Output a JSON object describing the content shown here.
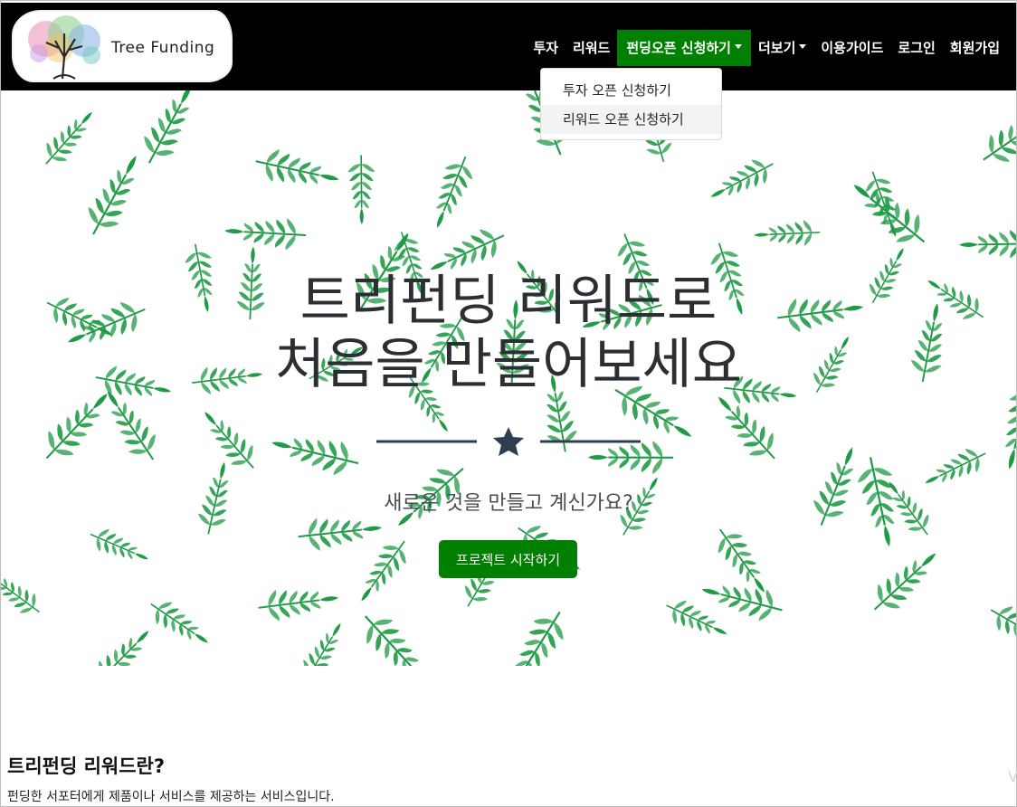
{
  "header": {
    "logo_text": "Tree Funding",
    "nav": [
      {
        "label": "투자"
      },
      {
        "label": "리워드"
      },
      {
        "label": "펀딩오픈 신청하기"
      },
      {
        "label": "더보기"
      },
      {
        "label": "이용가이드"
      },
      {
        "label": "로그인"
      },
      {
        "label": "회원가입"
      }
    ],
    "dropdown": [
      {
        "label": "투자 오픈 신청하기"
      },
      {
        "label": "리워드 오픈 신청하기"
      }
    ]
  },
  "hero": {
    "title_line1": "트리펀딩 리워드로",
    "title_line2": "처음을 만들어보세요",
    "subtitle": "새로운 것을 만들고 계신가요?",
    "cta_label": "프로젝트 시작하기"
  },
  "section": {
    "title": "트리펀딩 리워드란?",
    "description": "펀딩한 서포터에게 제품이나 서비스를 제공하는 서비스입니다."
  },
  "colors": {
    "nav_bg": "#000000",
    "accent": "#008000",
    "leaf": "#1f9a45",
    "text_dark": "#2b2f33"
  },
  "icons": [
    "logo-tree-icon",
    "caret-down-icon",
    "star-icon"
  ]
}
